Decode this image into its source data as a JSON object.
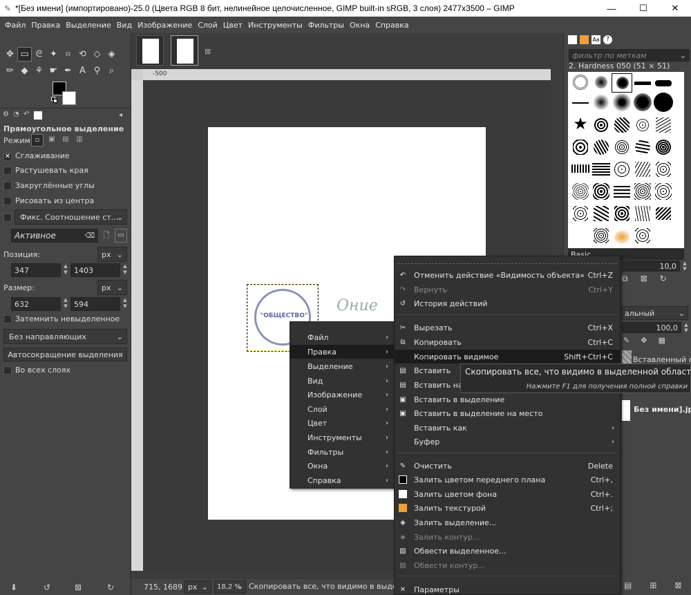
{
  "window": {
    "title": "*[Без имени] (импортировано)-25.0 (Цвета RGB 8 бит, нелинейное целочисленное, GIMP built-in sRGB, 3 слоя) 2477x3500 – GIMP"
  },
  "menubar": [
    "Файл",
    "Правка",
    "Выделение",
    "Вид",
    "Изображение",
    "Слой",
    "Цвет",
    "Инструменты",
    "Фильтры",
    "Окна",
    "Справка"
  ],
  "tool_options": {
    "title": "Прямоугольное выделение",
    "mode_label": "Режим:",
    "antialias": "Сглаживание",
    "feather": "Растушевать края",
    "rounded": "Закруглённые углы",
    "from_center": "Рисовать из центра",
    "fixed": "Фикс. Соотношение ст...",
    "active": "Активное",
    "position_label": "Позиция:",
    "pos_x": "347",
    "pos_y": "1403",
    "unit": "px",
    "size_label": "Размер:",
    "size_w": "632",
    "size_h": "594",
    "dim_unselected": "Затемнить невыделенное",
    "guides": "Без направляющих",
    "autoshrink": "Автосокращение выделения",
    "all_layers": "Во всех слоях"
  },
  "rulers": {
    "m500": "-500"
  },
  "status": {
    "coords": "715, 1689",
    "unit": "px",
    "zoom": "18,2 %",
    "message": "Скопировать все, что видимо в выделенной"
  },
  "stamp": {
    "text": "\"ОБЩЕСТВО\""
  },
  "signature": {
    "text": "Ониe"
  },
  "dock": {
    "filter_placeholder": "фильтр по меткам",
    "brush_name": "2. Hardness 050 (51 × 51)",
    "brush_set": "Basic",
    "spacing": "10,0",
    "mode_partial": "альный",
    "opacity": "100,0",
    "layer_name": "Вставленный с",
    "image_name": "Без имени].jpg"
  },
  "menu_main": [
    "Файл",
    "Правка",
    "Выделение",
    "Вид",
    "Изображение",
    "Слой",
    "Цвет",
    "Инструменты",
    "Фильтры",
    "Окна",
    "Справка"
  ],
  "menu_edit": {
    "undo": {
      "label": "Отменить действие «Видимость объекта»",
      "acc": "Ctrl+Z"
    },
    "redo": {
      "label": "Вернуть",
      "acc": "Ctrl+Y"
    },
    "history": {
      "label": "История действий"
    },
    "cut": {
      "label": "Вырезать",
      "acc": "Ctrl+X"
    },
    "copy": {
      "label": "Копировать",
      "acc": "Ctrl+C"
    },
    "copy_visible": {
      "label": "Копировать видимое",
      "acc": "Shift+Ctrl+C"
    },
    "paste": {
      "label": "Вставить"
    },
    "paste_in_place": {
      "label": "Вставить на м"
    },
    "paste_into": {
      "label": "Вставить в выделение"
    },
    "paste_into_place": {
      "label": "Вставить в выделение на место"
    },
    "paste_as": {
      "label": "Вставить как"
    },
    "buffer": {
      "label": "Буфер"
    },
    "clear": {
      "label": "Очистить",
      "acc": "Delete"
    },
    "fill_fg": {
      "label": "Залить цветом переднего плана",
      "acc": "Ctrl+,"
    },
    "fill_bg": {
      "label": "Залить цветом фона",
      "acc": "Ctrl+."
    },
    "fill_pattern": {
      "label": "Залить текстурой",
      "acc": "Ctrl+;"
    },
    "fill_selection": {
      "label": "Залить выделение..."
    },
    "fill_path": {
      "label": "Залить контур..."
    },
    "stroke_selection": {
      "label": "Обвести выделенное..."
    },
    "stroke_path": {
      "label": "Обвести контур..."
    },
    "preferences": {
      "label": "Параметры"
    }
  },
  "tooltip": {
    "main": "Скопировать все, что видимо в выделенной области",
    "hint": "Нажмите F1 для получения полной справки"
  },
  "colors": {
    "menu_bg": "#323232",
    "highlight": "#1c1c1c",
    "pattern_orange": "#f0a030"
  }
}
